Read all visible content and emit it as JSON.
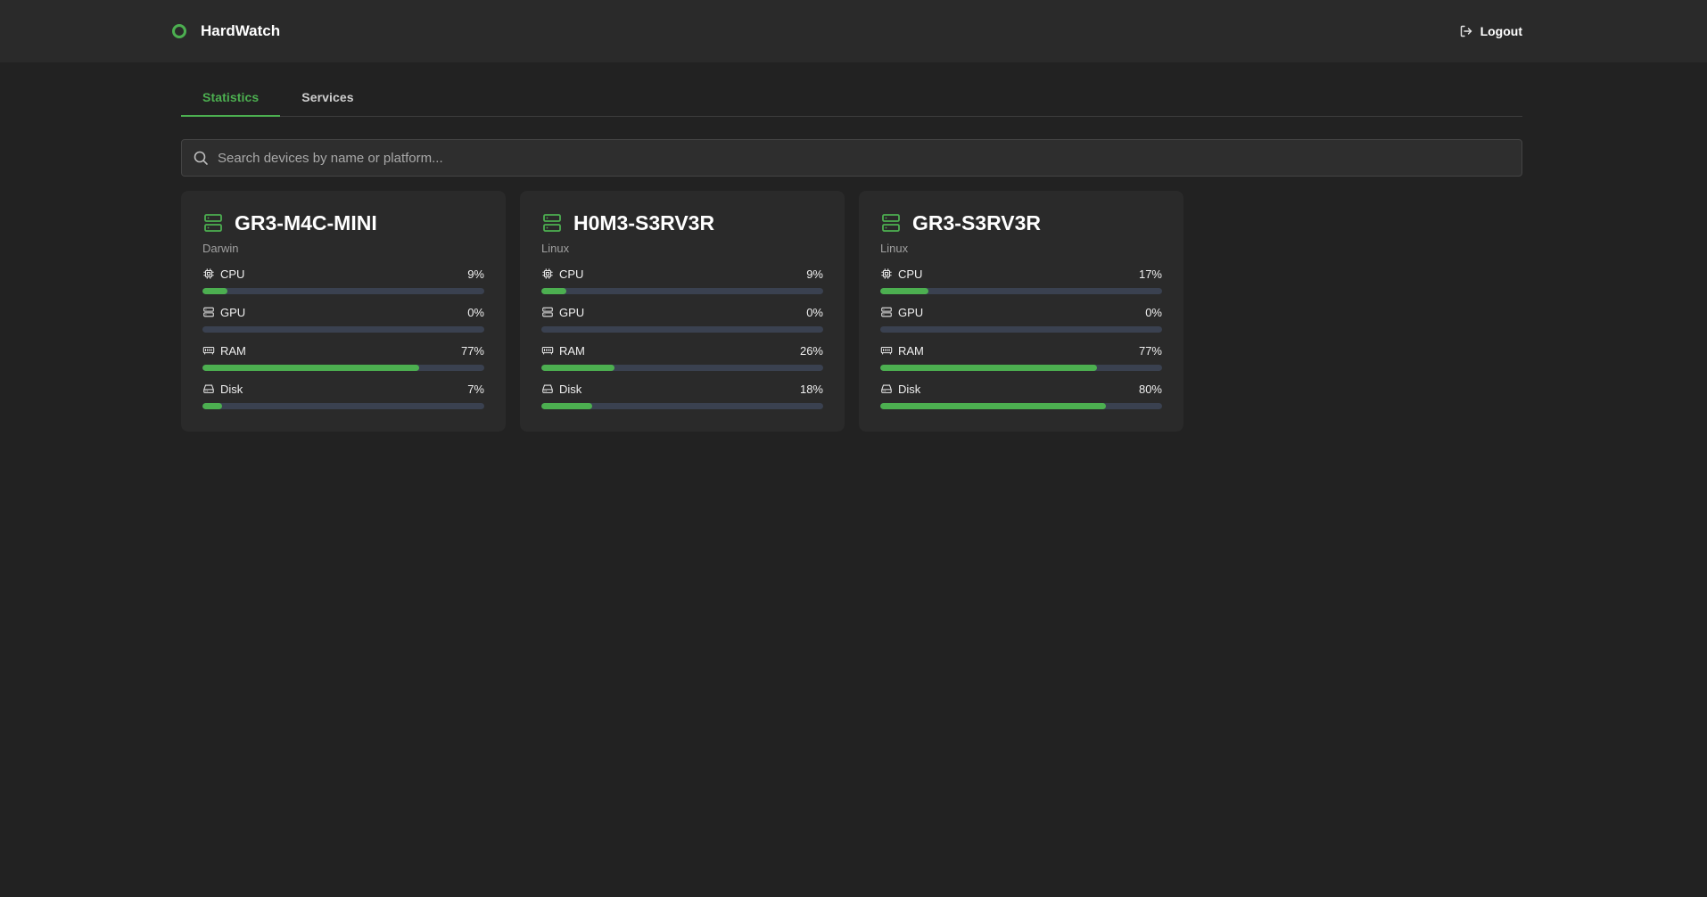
{
  "app": {
    "name": "HardWatch",
    "accent": "#4caf50",
    "logout_label": "Logout"
  },
  "tabs": [
    {
      "label": "Statistics",
      "active": true
    },
    {
      "label": "Services",
      "active": false
    }
  ],
  "search": {
    "placeholder": "Search devices by name or platform...",
    "value": ""
  },
  "devices": [
    {
      "name": "GR3-M4C-MINI",
      "platform": "Darwin",
      "metrics": [
        {
          "label": "CPU",
          "value": "9%",
          "percent": 9,
          "icon": "cpu-icon"
        },
        {
          "label": "GPU",
          "value": "0%",
          "percent": 0,
          "icon": "gpu-icon"
        },
        {
          "label": "RAM",
          "value": "77%",
          "percent": 77,
          "icon": "ram-icon"
        },
        {
          "label": "Disk",
          "value": "7%",
          "percent": 7,
          "icon": "disk-icon"
        }
      ]
    },
    {
      "name": "H0M3-S3RV3R",
      "platform": "Linux",
      "metrics": [
        {
          "label": "CPU",
          "value": "9%",
          "percent": 9,
          "icon": "cpu-icon"
        },
        {
          "label": "GPU",
          "value": "0%",
          "percent": 0,
          "icon": "gpu-icon"
        },
        {
          "label": "RAM",
          "value": "26%",
          "percent": 26,
          "icon": "ram-icon"
        },
        {
          "label": "Disk",
          "value": "18%",
          "percent": 18,
          "icon": "disk-icon"
        }
      ]
    },
    {
      "name": "GR3-S3RV3R",
      "platform": "Linux",
      "metrics": [
        {
          "label": "CPU",
          "value": "17%",
          "percent": 17,
          "icon": "cpu-icon"
        },
        {
          "label": "GPU",
          "value": "0%",
          "percent": 0,
          "icon": "gpu-icon"
        },
        {
          "label": "RAM",
          "value": "77%",
          "percent": 77,
          "icon": "ram-icon"
        },
        {
          "label": "Disk",
          "value": "80%",
          "percent": 80,
          "icon": "disk-icon"
        }
      ]
    }
  ]
}
